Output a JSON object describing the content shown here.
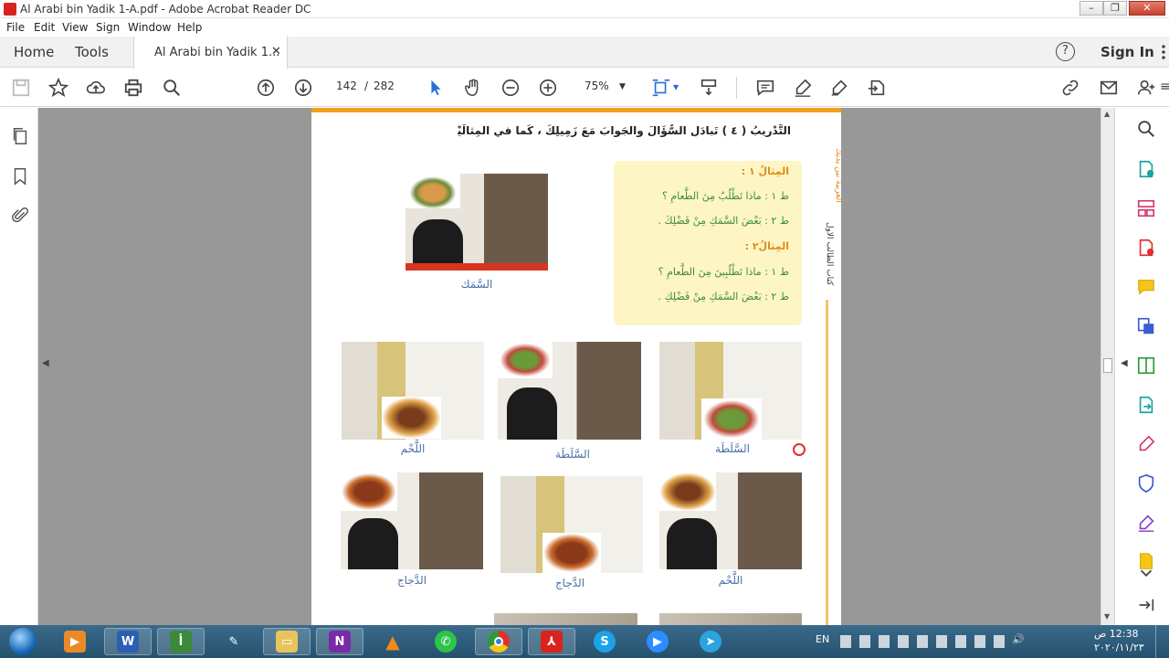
{
  "window": {
    "title": "Al Arabi bin Yadik 1-A.pdf - Adobe Acrobat Reader DC",
    "minimize": "–",
    "maximize": "❐",
    "close": "✕"
  },
  "menu": [
    "File",
    "Edit",
    "View",
    "Sign",
    "Window",
    "Help"
  ],
  "tabs": {
    "home": "Home",
    "tools": "Tools",
    "document": "Al Arabi bin Yadik 1...",
    "close": "✕",
    "help": "?",
    "sign_in": "Sign In"
  },
  "toolbar": {
    "current_page": "142",
    "page_sep": "/",
    "total_pages": "282",
    "zoom": "75%",
    "icons": [
      "save-icon",
      "bookmark-star-icon",
      "upload-icon",
      "print-icon",
      "search-icon",
      "page-up-icon",
      "page-down-icon",
      "select-cursor-icon",
      "hand-icon",
      "zoom-out-icon",
      "zoom-in-icon",
      "fit-page-icon",
      "scroll-mode-icon",
      "comment-icon",
      "highlight-icon",
      "sign-icon",
      "share-icon",
      "link-icon",
      "email-icon",
      "add-user-icon"
    ]
  },
  "left_panel": [
    "pages-icon",
    "bookmark-icon",
    "attachment-icon"
  ],
  "right_panel": [
    "zoom-icon",
    "export-pdf-icon",
    "organize-pages-icon",
    "create-pdf-icon",
    "comment-icon",
    "combine-files-icon",
    "edit-pdf-icon",
    "send-icon",
    "fill-sign-icon",
    "protect-icon",
    "sign-pen-icon",
    "tools-more-icon",
    "chevron-down-icon",
    "collapse-panel-icon"
  ],
  "pdf": {
    "instruction": "التَّدْرِيبُ ( ٤ ) تَبادَلِ السُّؤَالَ والجَوابَ مَعَ زَمِيلِكَ ، كَما في المِثالَيْنِ.",
    "side_label_1": "العربية بين يديك",
    "side_label_2": "كتاب الطالب الأول",
    "example1_title": "المِثالُ ١ :",
    "example1_q": "ط ١ : ماذا تَطْلُبُ مِنَ الطَّعامِ ؟",
    "example1_a": "ط ٢ : بَعْضَ السَّمَكِ مِنْ فَضْلِكَ .",
    "example2_title": "المِثالُ٢ :",
    "example2_q": "ط ١ : ماذا تَطْلُبِينَ مِنَ الطَّعامِ ؟",
    "example2_a": "ط ٢ : بَعْضَ السَّمَكِ مِنْ فَضْلِكِ .",
    "top_caption": "السَّمَك",
    "row1_captions": [
      "السَّلَطَة",
      "السَّلَطَة",
      "اللَّحْم"
    ],
    "row2_captions": [
      "اللَّحْم",
      "الدَّجاج",
      "الدَّجاج"
    ]
  },
  "taskbar": {
    "apps": [
      "start-orb-icon",
      "media-player-icon",
      "word-icon",
      "aban-app-icon",
      "pen-icon",
      "file-explorer-icon",
      "onenote-icon",
      "vlc-icon",
      "whatsapp-icon",
      "chrome-icon",
      "acrobat-icon",
      "skype-icon",
      "zoom-app-icon",
      "telegram-icon"
    ],
    "language": "EN",
    "time": "12:38 ص",
    "date": "٢٠٢٠/١١/٢٣"
  },
  "colors": {
    "accent_orange": "#f0a01e",
    "example_bg": "#fdf6c4",
    "example_title": "#e08a1a",
    "example_text": "#3f8a3a",
    "caption": "#4a6fa5"
  }
}
